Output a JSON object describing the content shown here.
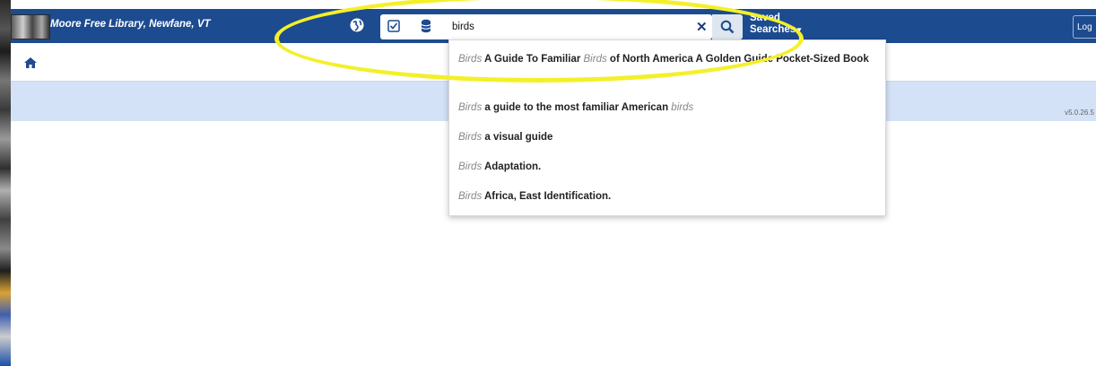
{
  "header": {
    "library_name": "Moore Free Library, Newfane, VT",
    "saved_searches_line1": "Saved",
    "saved_searches_line2": "Searches",
    "login_label": "Log"
  },
  "search": {
    "value": "birds",
    "suggestions": [
      {
        "prefix": "Birds",
        "text_a": " A Guide To Familiar ",
        "mid": "Birds",
        "text_b": " of North America A Golden Guide Pocket-Sized Book"
      },
      {
        "prefix": "Birds",
        "text_a": " a guide to the most familiar American ",
        "mid": "birds",
        "text_b": ""
      },
      {
        "prefix": "Birds",
        "text_a": " a visual guide",
        "mid": "",
        "text_b": ""
      },
      {
        "prefix": "Birds",
        "text_a": " Adaptation.",
        "mid": "",
        "text_b": ""
      },
      {
        "prefix": "Birds",
        "text_a": " Africa, East Identification.",
        "mid": "",
        "text_b": ""
      }
    ]
  },
  "footer": {
    "version": "v5.0.26.5"
  },
  "colors": {
    "header_bg": "#1d4b8f",
    "banner_bg": "#d3e2f6",
    "highlight_oval": "#f3f02a"
  },
  "icons": [
    "globe-icon",
    "checkbox-icon",
    "database-icon",
    "clear-icon",
    "search-icon",
    "home-icon"
  ]
}
